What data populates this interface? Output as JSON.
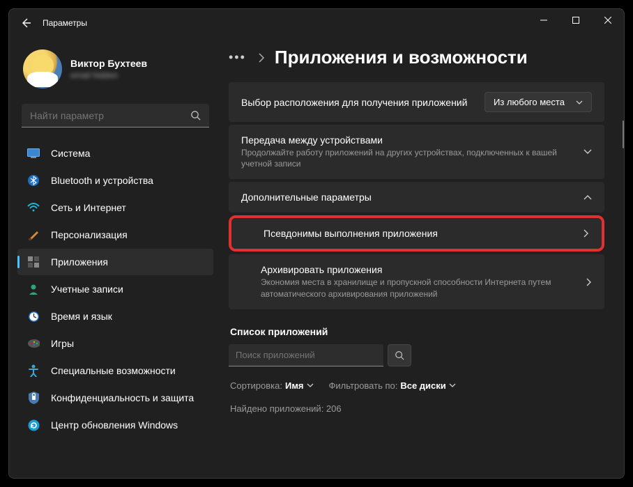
{
  "window": {
    "title": "Параметры"
  },
  "profile": {
    "name": "Виктор Бухтеев",
    "email": "email hidden"
  },
  "search": {
    "placeholder": "Найти параметр"
  },
  "sidebar": {
    "items": [
      {
        "label": "Система",
        "icon": "system"
      },
      {
        "label": "Bluetooth и устройства",
        "icon": "bluetooth"
      },
      {
        "label": "Сеть и Интернет",
        "icon": "wifi"
      },
      {
        "label": "Персонализация",
        "icon": "brush"
      },
      {
        "label": "Приложения",
        "icon": "apps",
        "active": true
      },
      {
        "label": "Учетные записи",
        "icon": "account"
      },
      {
        "label": "Время и язык",
        "icon": "time"
      },
      {
        "label": "Игры",
        "icon": "games"
      },
      {
        "label": "Специальные возможности",
        "icon": "accessibility"
      },
      {
        "label": "Конфиденциальность и защита",
        "icon": "shield"
      },
      {
        "label": "Центр обновления Windows",
        "icon": "update"
      }
    ]
  },
  "breadcrumb": {
    "title": "Приложения и возможности"
  },
  "cards": {
    "install_source": {
      "title": "Выбор расположения для получения приложений",
      "dropdown": "Из любого места"
    },
    "share_devices": {
      "title": "Передача между устройствами",
      "desc": "Продолжайте работу приложений на других устройствах, подключенных к вашей учетной записи"
    },
    "advanced": {
      "title": "Дополнительные параметры"
    },
    "aliases": {
      "title": "Псевдонимы выполнения приложения"
    },
    "archive": {
      "title": "Архивировать приложения",
      "desc": "Экономия места в хранилище и пропускной способности Интернета путем автоматического архивирования приложений"
    }
  },
  "apps": {
    "section": "Список приложений",
    "search_placeholder": "Поиск приложений",
    "sort_label": "Сортировка:",
    "sort_value": "Имя",
    "filter_label": "Фильтровать по:",
    "filter_value": "Все диски",
    "found": "Найдено приложений: 206"
  }
}
